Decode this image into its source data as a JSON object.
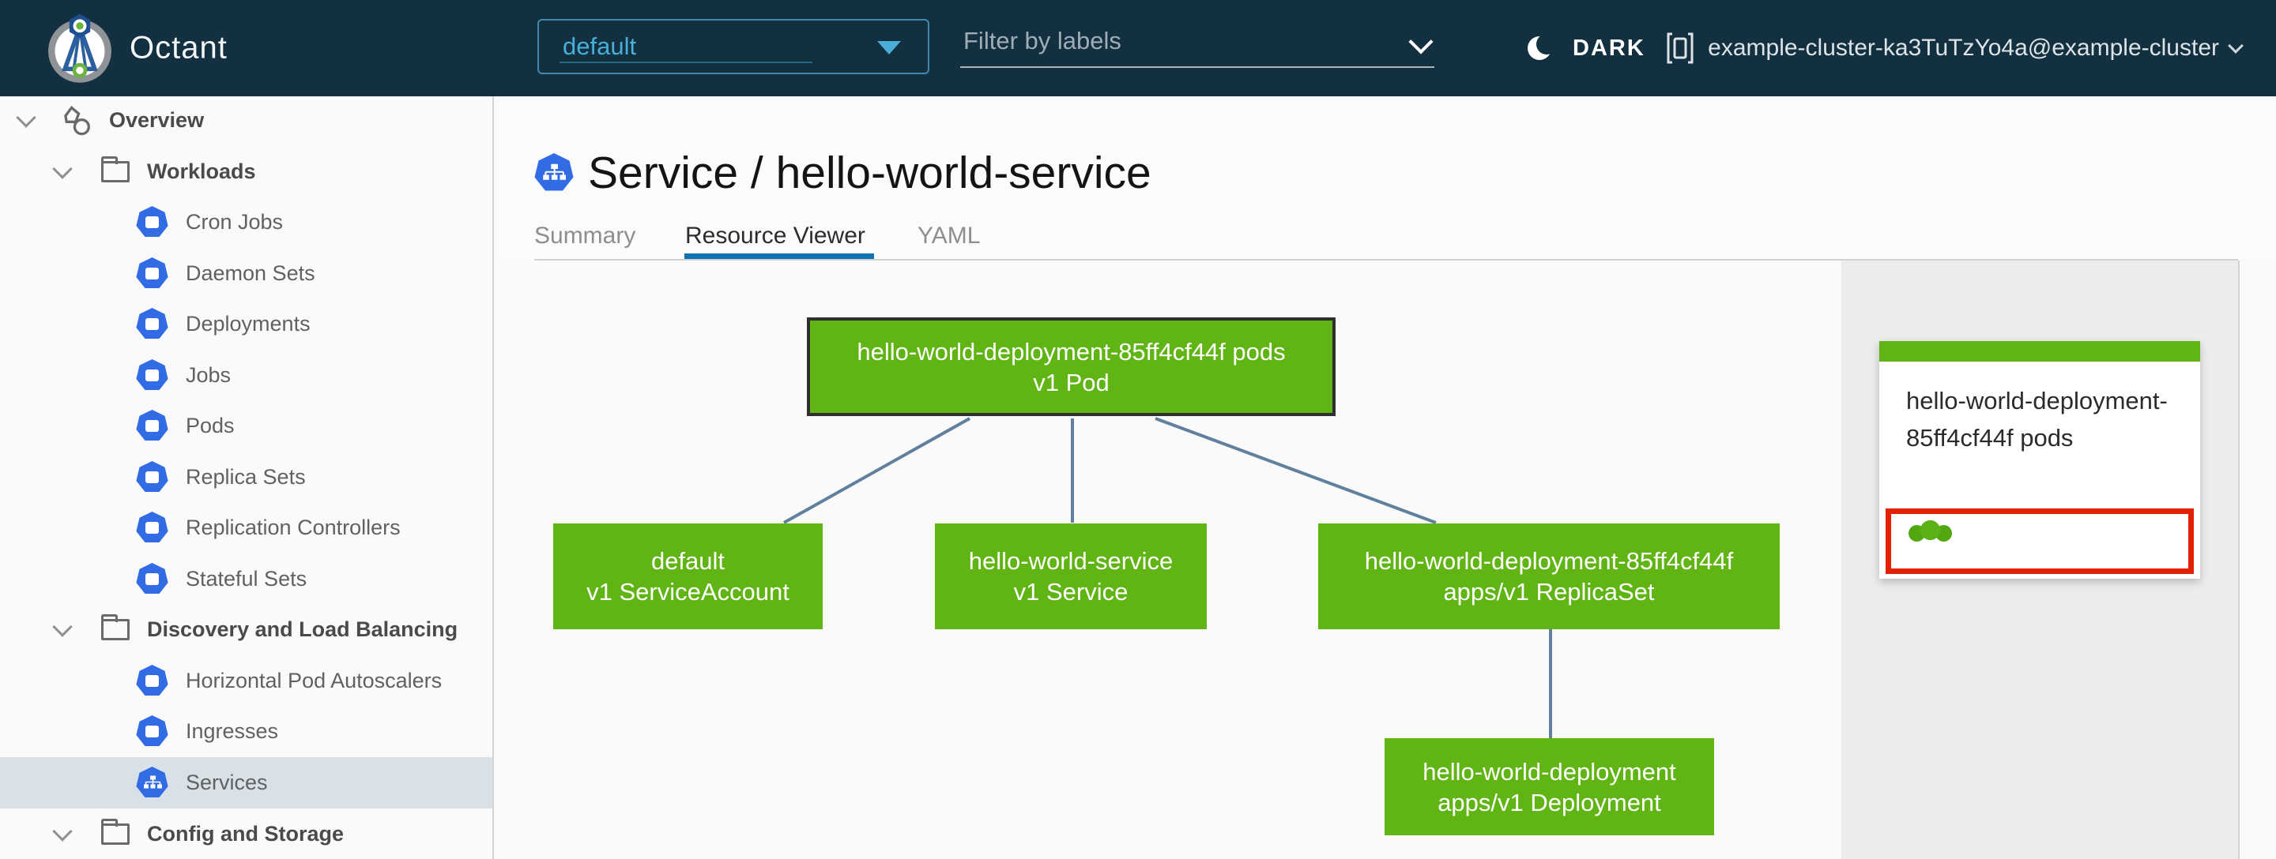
{
  "header": {
    "app_title": "Octant",
    "namespace_select": {
      "value": "default"
    },
    "label_filter": {
      "placeholder": "Filter by labels"
    },
    "theme_toggle_label": "DARK",
    "context_label": "example-cluster-ka3TuTzYo4a@example-cluster"
  },
  "sidebar": {
    "items": [
      {
        "label": "Overview",
        "level": 0,
        "icon": "applications-icon",
        "expanded": true
      },
      {
        "label": "Workloads",
        "level": 1,
        "icon": "folder-icon",
        "expanded": true
      },
      {
        "label": "Cron Jobs",
        "level": 2,
        "icon": "cronjobs-icon"
      },
      {
        "label": "Daemon Sets",
        "level": 2,
        "icon": "daemonsets-icon"
      },
      {
        "label": "Deployments",
        "level": 2,
        "icon": "deployments-icon"
      },
      {
        "label": "Jobs",
        "level": 2,
        "icon": "jobs-icon"
      },
      {
        "label": "Pods",
        "level": 2,
        "icon": "pods-icon"
      },
      {
        "label": "Replica Sets",
        "level": 2,
        "icon": "replicasets-icon"
      },
      {
        "label": "Replication Controllers",
        "level": 2,
        "icon": "replicationcontrollers-icon"
      },
      {
        "label": "Stateful Sets",
        "level": 2,
        "icon": "statefulsets-icon"
      },
      {
        "label": "Discovery and Load Balancing",
        "level": 1,
        "icon": "folder-icon",
        "expanded": true
      },
      {
        "label": "Horizontal Pod Autoscalers",
        "level": 2,
        "icon": "horizontalpodautoscalers-icon"
      },
      {
        "label": "Ingresses",
        "level": 2,
        "icon": "ingresses-icon"
      },
      {
        "label": "Services",
        "level": 2,
        "icon": "services-icon",
        "selected": true
      },
      {
        "label": "Config and Storage",
        "level": 1,
        "icon": "folder-icon",
        "expanded": true
      }
    ]
  },
  "main": {
    "title": "Service / hello-world-service",
    "tabs": [
      {
        "label": "Summary",
        "active": false
      },
      {
        "label": "Resource Viewer",
        "active": true
      },
      {
        "label": "YAML",
        "active": false
      }
    ]
  },
  "graph": {
    "nodes": [
      {
        "id": "pod",
        "line1": "hello-world-deployment-85ff4cf44f pods",
        "line2": "v1 Pod",
        "status": "ok",
        "selected": true
      },
      {
        "id": "serviceaccount",
        "line1": "default",
        "line2": "v1 ServiceAccount",
        "status": "ok"
      },
      {
        "id": "service",
        "line1": "hello-world-service",
        "line2": "v1 Service",
        "status": "ok"
      },
      {
        "id": "replicaset",
        "line1": "hello-world-deployment-85ff4cf44f",
        "line2": "apps/v1 ReplicaSet",
        "status": "ok"
      },
      {
        "id": "deployment",
        "line1": "hello-world-deployment",
        "line2": "apps/v1 Deployment",
        "status": "ok"
      }
    ],
    "edges": [
      [
        "pod",
        "serviceaccount"
      ],
      [
        "pod",
        "service"
      ],
      [
        "pod",
        "replicaset"
      ],
      [
        "replicaset",
        "deployment"
      ]
    ]
  },
  "side_panel": {
    "card": {
      "title": "hello-world-deployment-85ff4cf44f pods",
      "pod_status_count": 3,
      "status": "ok"
    }
  },
  "colors": {
    "header_bg": "#12303f",
    "k8s_blue": "#326ce5",
    "node_ok_green": "#60b515",
    "edge_blue": "#60809e",
    "selected_nav_bg": "#d8e1e8",
    "tab_active_blue": "#0f73b1",
    "highlight_red": "#e12200",
    "namespace_accent": "#49afd9"
  }
}
